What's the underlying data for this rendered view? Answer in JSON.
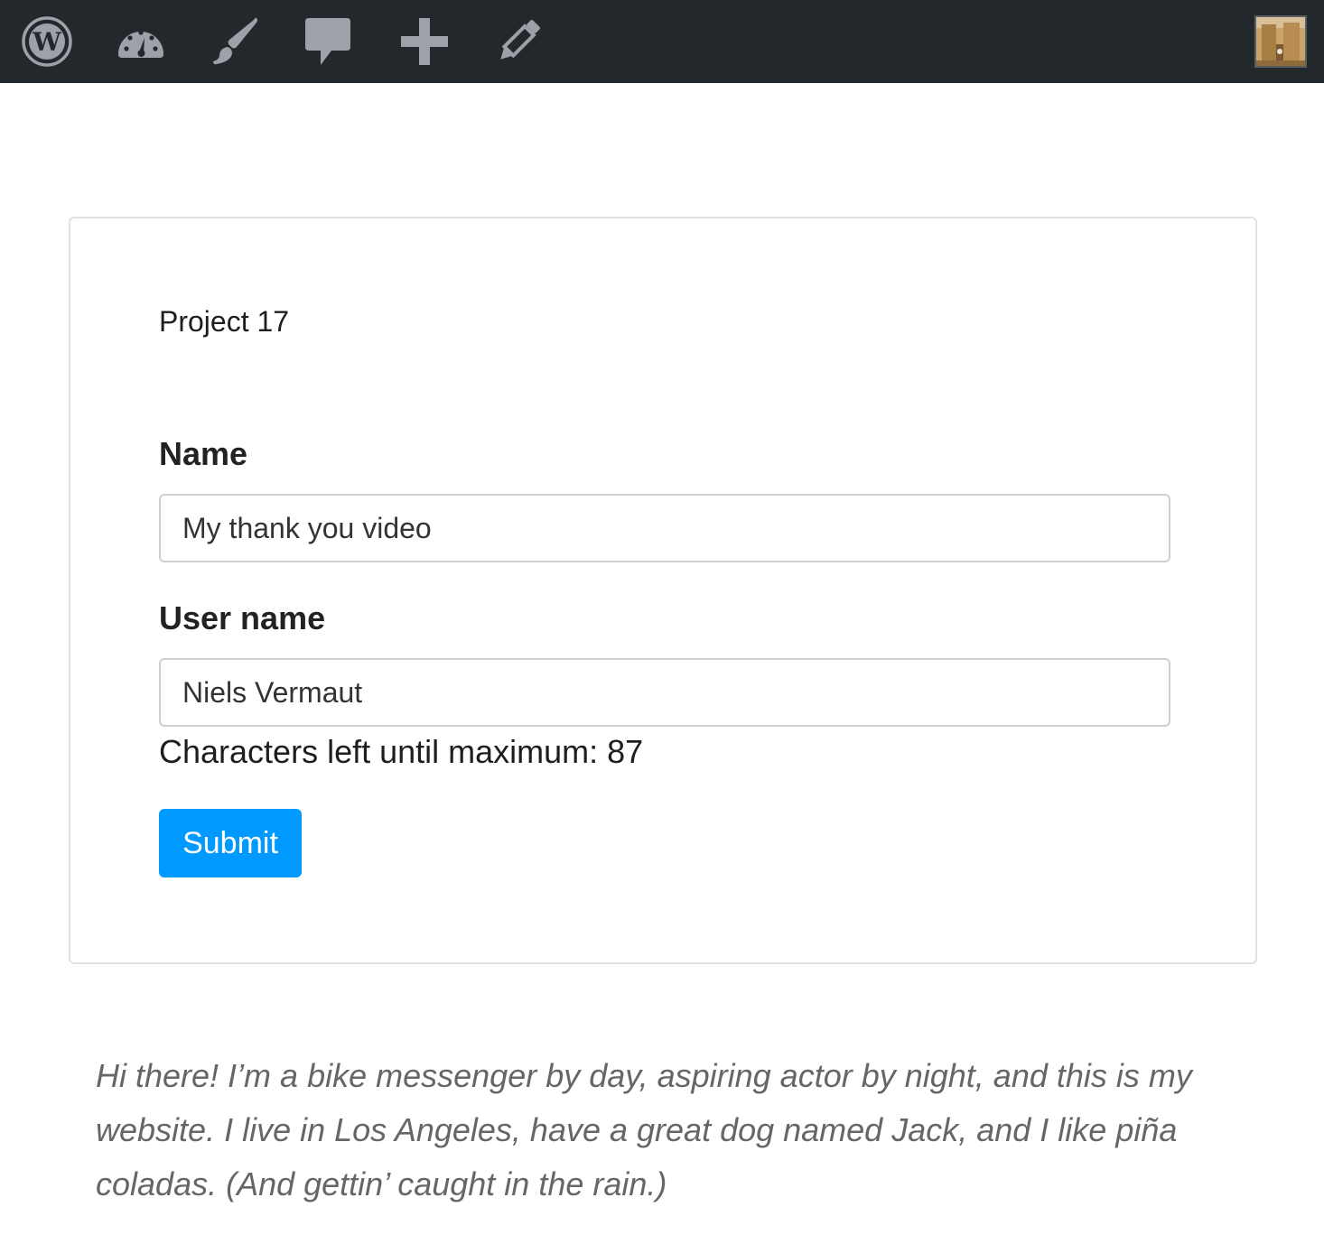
{
  "admin_bar": {
    "icons": [
      "wordpress-icon",
      "dashboard-icon",
      "customize-brush-icon",
      "comments-icon",
      "new-content-plus-icon",
      "edit-pencil-icon"
    ],
    "avatar": "user-avatar"
  },
  "form": {
    "project_title": "Project 17",
    "name_label": "Name",
    "name_value": "My thank you video",
    "username_label": "User name",
    "username_value": "Niels Vermaut",
    "char_count_text": "Characters left until maximum: 87",
    "submit_label": "Submit"
  },
  "bio": {
    "text": "Hi there! I’m a bike messenger by day, aspiring actor by night, and this is my website. I live in Los Angeles, have a great dog named Jack, and I like piña coladas. (And gettin’ caught in the rain.)"
  },
  "colors": {
    "admin_bar_bg": "#23282d",
    "icon_color": "#9ca2a7",
    "submit_bg": "#0099ff",
    "bio_text": "#666666"
  }
}
